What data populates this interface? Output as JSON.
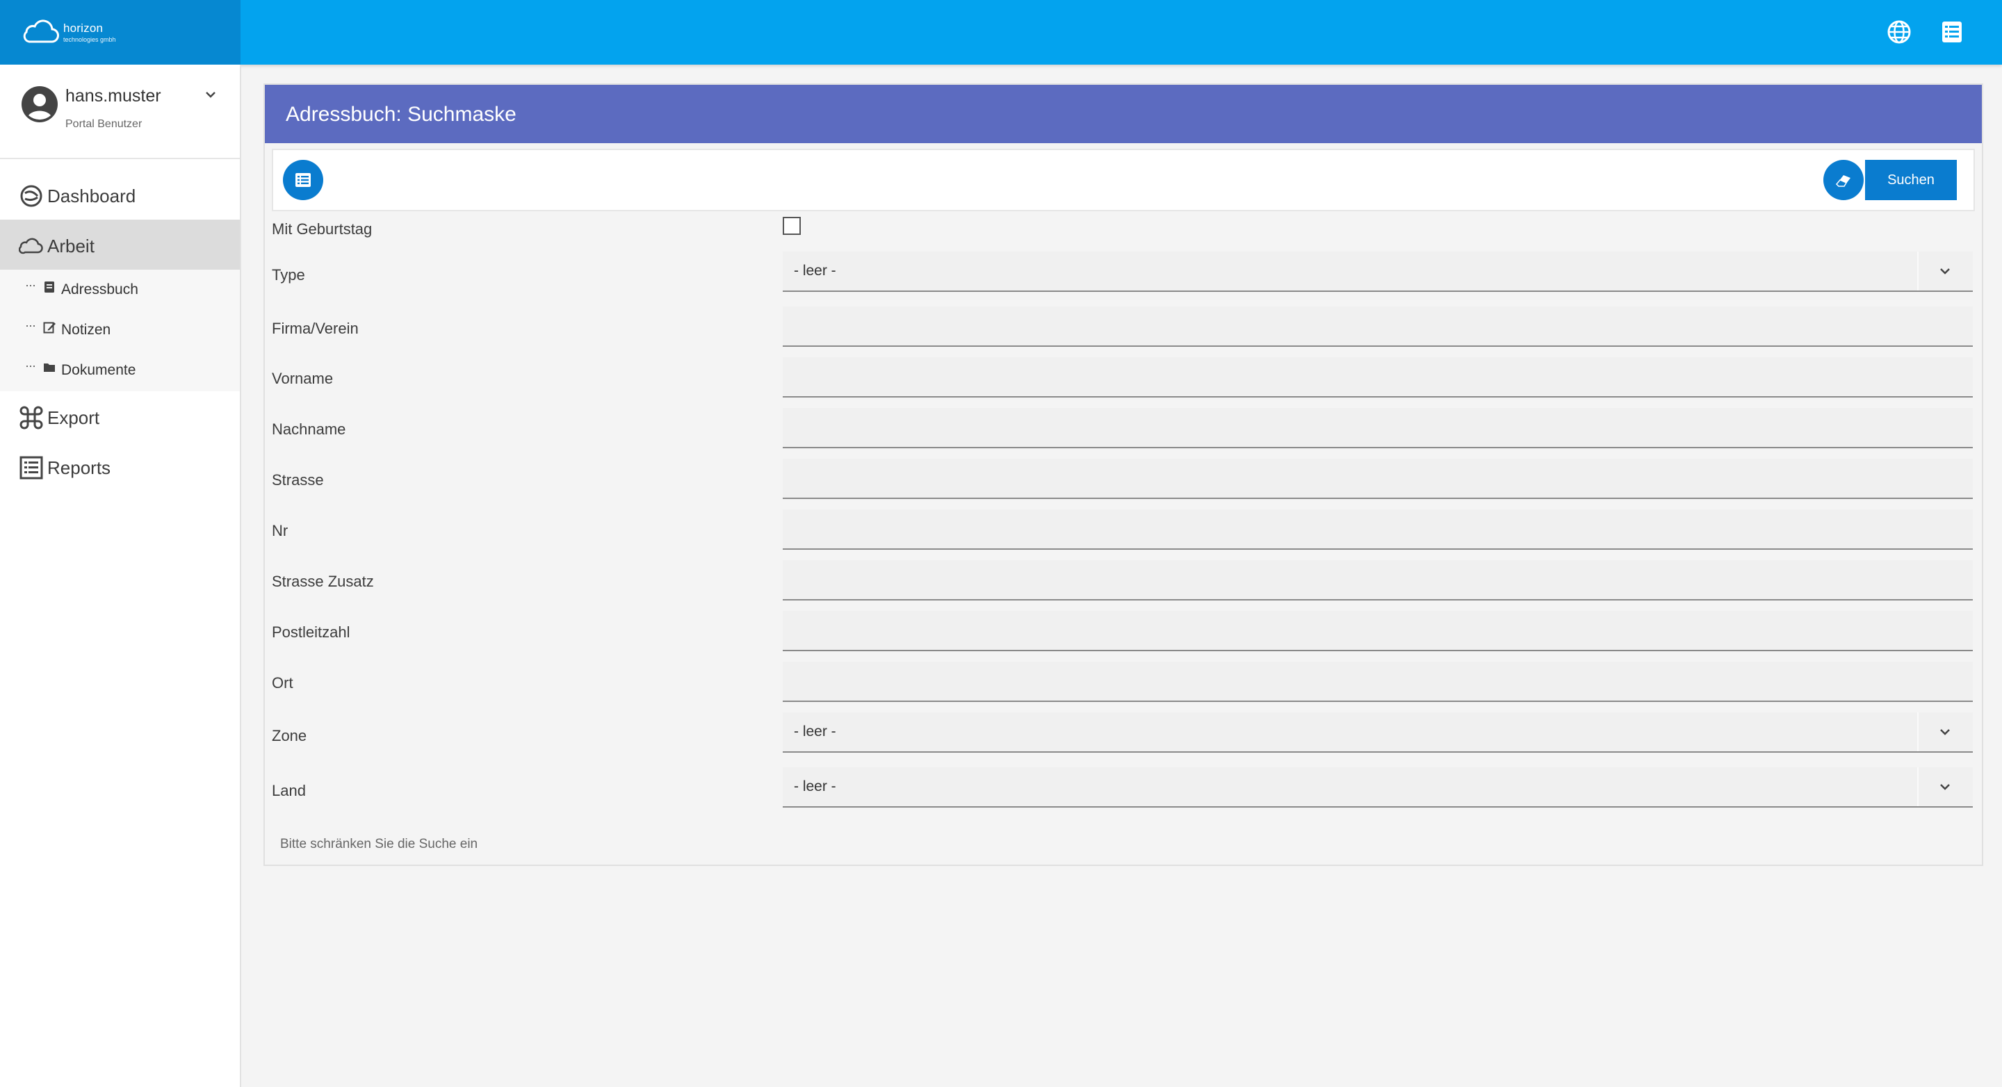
{
  "brand": {
    "name": "horizon",
    "subtitle": "technologies gmbh"
  },
  "topbar": {
    "icons": [
      "globe-icon",
      "list-icon"
    ]
  },
  "user": {
    "name": "hans.muster",
    "role": "Portal Benutzer"
  },
  "sidebar": {
    "items": [
      {
        "label": "Dashboard",
        "icon": "dashboard-icon"
      },
      {
        "label": "Arbeit",
        "icon": "cloud-icon",
        "active": true
      },
      {
        "label": "Export",
        "icon": "command-icon"
      },
      {
        "label": "Reports",
        "icon": "report-icon"
      }
    ],
    "subitems": [
      {
        "label": "Adressbuch",
        "icon": "book-icon"
      },
      {
        "label": "Notizen",
        "icon": "edit-icon"
      },
      {
        "label": "Dokumente",
        "icon": "folder-icon"
      }
    ]
  },
  "card": {
    "title": "Adressbuch: Suchmaske",
    "search_label": "Suchen",
    "hint": "Bitte schränken Sie die Suche ein"
  },
  "form": {
    "birthday": {
      "label": "Mit Geburtstag",
      "checked": false
    },
    "type": {
      "label": "Type",
      "value": "- leer -"
    },
    "firma": {
      "label": "Firma/Verein",
      "value": ""
    },
    "vorname": {
      "label": "Vorname",
      "value": ""
    },
    "nachname": {
      "label": "Nachname",
      "value": ""
    },
    "strasse": {
      "label": "Strasse",
      "value": ""
    },
    "nr": {
      "label": "Nr",
      "value": ""
    },
    "strasse_zusatz": {
      "label": "Strasse Zusatz",
      "value": ""
    },
    "plz": {
      "label": "Postleitzahl",
      "value": ""
    },
    "ort": {
      "label": "Ort",
      "value": ""
    },
    "zone": {
      "label": "Zone",
      "value": "- leer -"
    },
    "land": {
      "label": "Land",
      "value": "- leer -"
    }
  },
  "colors": {
    "topbar": "#03a3ee",
    "brand_bg": "#0688d1",
    "card_header": "#5c6bc0",
    "button": "#0a7ccf"
  }
}
